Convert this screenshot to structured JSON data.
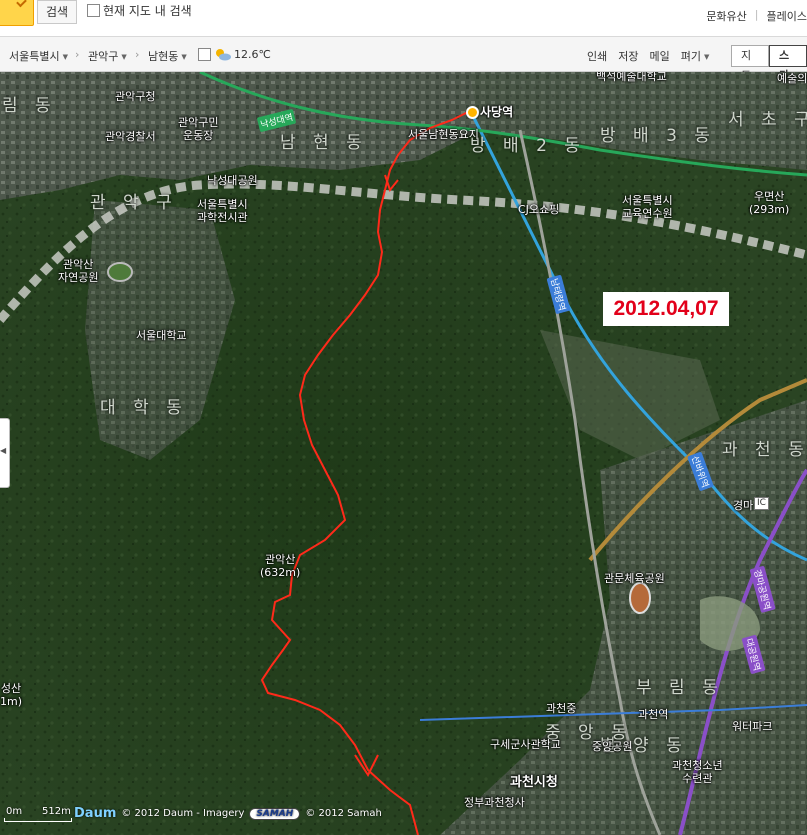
{
  "top_bar": {
    "search_button": "검색",
    "map_search_checkbox_label": "현재 지도 내 검색",
    "links": [
      "문화유산",
      "플레이스"
    ]
  },
  "toolbar": {
    "region_city": "서울특별시",
    "region_district": "관악구",
    "region_dong": "남현동",
    "temperature": "12.6℃",
    "links": [
      "인쇄",
      "저장",
      "메일",
      "펴기"
    ],
    "map_types": [
      "지도",
      "스카"
    ]
  },
  "map": {
    "overlay_date": "2012.04,07",
    "area_labels": [
      "관 악 구",
      "서 초 구",
      "방 배 3 동",
      "남 현 동",
      "방 배 2 동",
      "대 학 동",
      "과 천 동",
      "부 림 동",
      "별 양 동",
      "림 동",
      "중 앙 동"
    ],
    "place_labels": {
      "gwanak_gu_office": "관악구청",
      "gwanak_police": "관악경찰서",
      "gwanak_gym_1": "관악구민",
      "gwanak_gym_2": "운동장",
      "naksungdae_park": "낙성대공원",
      "science_center_1": "서울특별시",
      "science_center_2": "과학전시관",
      "gwanaksan_natural_park_1": "관악산",
      "gwanaksan_natural_park_2": "자연공원",
      "snu": "서울대학교",
      "sadang_station": "사당역",
      "namhyeon_junction": "서울남현동요지",
      "cj_shopping": "CJ오쇼핑",
      "edu_institute_1": "서울특별시",
      "edu_institute_2": "교육연수원",
      "umyeonsan": "우면산",
      "umyeonsan_height": "(293m)",
      "gwanaksan": "관악산",
      "gwanaksan_height": "(632m)",
      "art_school": "백석예술대학교",
      "gwanmun_stadium": "관문체육공원",
      "gwacheon_station_top": "과천중",
      "gwacheon_station": "과천역",
      "military_museum": "구세군사관학교",
      "gwacheon_city_hall": "과천시청",
      "gov_complex": "정부과천청사",
      "central_park": "중앙공원",
      "youth_center_1": "과천청소년",
      "youth_center_2": "수련관",
      "water_park": "워터파크",
      "gyeongma_ic": "경마",
      "ic_badge": "IC",
      "west_mountain": "성산",
      "west_mountain_height": "1m)",
      "top_right_partial": "예술의"
    },
    "road_labels": [
      "낙성대역",
      "남태령역",
      "선바위역",
      "경마공원역",
      "대공원역"
    ],
    "scale_labels": [
      "0m",
      "512m"
    ],
    "brand_logo": "Daum",
    "copyright_1": "© 2012 Daum - Imagery",
    "samah_logo": "SAMAH",
    "copyright_2": "© 2012 Samah",
    "colors": {
      "route": "#ff2a1a",
      "line4_blue": "#33a3dc",
      "line2_green": "#27a85a",
      "line4_gold": "#b38a3a",
      "purple_line": "#8a4fc8",
      "date_text": "#e2001a"
    }
  }
}
